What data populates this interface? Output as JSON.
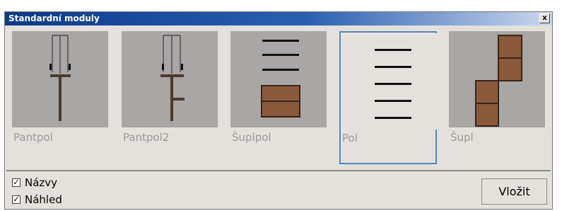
{
  "window": {
    "title": "Standardní moduly",
    "close_label": "x"
  },
  "modules": [
    {
      "label": "Pantpol",
      "icon": "pantpol-icon",
      "selected": false
    },
    {
      "label": "Pantpol2",
      "icon": "pantpol2-icon",
      "selected": false
    },
    {
      "label": "Šuplpol",
      "icon": "suplpol-icon",
      "selected": false
    },
    {
      "label": "Pol",
      "icon": "pol-icon",
      "selected": true
    },
    {
      "label": "Šupl",
      "icon": "supl-icon",
      "selected": false
    }
  ],
  "options": {
    "names_label": "Názvy",
    "names_checked": true,
    "preview_label": "Náhled",
    "preview_checked": true
  },
  "insert_button_label": "Vložit",
  "colors": {
    "title_bar": "#0d3a8a",
    "dialog_background": "#e4e1dc",
    "thumbnail_background": "#a9a6a6",
    "drawer_fill": "#8b5a3c",
    "selection_border": "#5a86bd"
  }
}
